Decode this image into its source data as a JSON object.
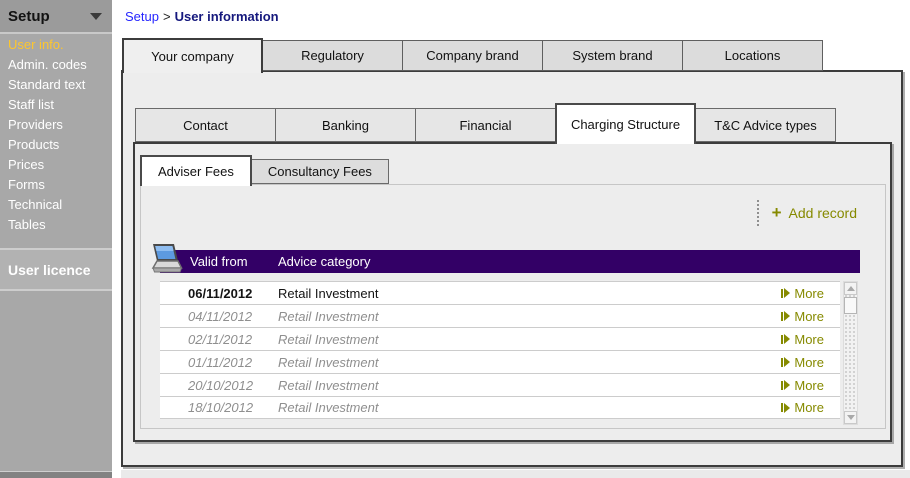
{
  "sidebar": {
    "title": "Setup",
    "items": [
      {
        "label": "User info.",
        "selected": true
      },
      {
        "label": "Admin. codes",
        "selected": false
      },
      {
        "label": "Standard text",
        "selected": false
      },
      {
        "label": "Staff list",
        "selected": false
      },
      {
        "label": "Providers",
        "selected": false
      },
      {
        "label": "Products",
        "selected": false
      },
      {
        "label": "Prices",
        "selected": false
      },
      {
        "label": "Forms",
        "selected": false
      },
      {
        "label": "Technical",
        "selected": false
      },
      {
        "label": "Tables",
        "selected": false
      }
    ],
    "section_title": "User licence"
  },
  "breadcrumb": {
    "link": "Setup",
    "separator": ">",
    "current": "User information"
  },
  "tabs": {
    "primary": [
      {
        "label": "Your company",
        "active": true
      },
      {
        "label": "Regulatory",
        "active": false
      },
      {
        "label": "Company brand",
        "active": false
      },
      {
        "label": "System brand",
        "active": false
      },
      {
        "label": "Locations",
        "active": false
      }
    ],
    "secondary": [
      {
        "label": "Contact",
        "active": false
      },
      {
        "label": "Banking",
        "active": false
      },
      {
        "label": "Financial",
        "active": false
      },
      {
        "label": "Charging Structure",
        "active": true
      },
      {
        "label": "T&C Advice types",
        "active": false
      }
    ],
    "fees": [
      {
        "label": "Adviser Fees",
        "active": true
      },
      {
        "label": "Consultancy Fees",
        "active": false
      }
    ]
  },
  "toolbar": {
    "add_icon": "+",
    "add_record_label": "Add record"
  },
  "table": {
    "columns": [
      "Valid from",
      "Advice category"
    ],
    "more_label": "More",
    "rows": [
      {
        "valid_from": "06/11/2012",
        "advice_category": "Retail Investment",
        "current": true
      },
      {
        "valid_from": "04/11/2012",
        "advice_category": "Retail Investment",
        "current": false
      },
      {
        "valid_from": "02/11/2012",
        "advice_category": "Retail Investment",
        "current": false
      },
      {
        "valid_from": "01/11/2012",
        "advice_category": "Retail Investment",
        "current": false
      },
      {
        "valid_from": "20/10/2012",
        "advice_category": "Retail Investment",
        "current": false
      },
      {
        "valid_from": "18/10/2012",
        "advice_category": "Retail Investment",
        "current": false
      }
    ]
  },
  "colors": {
    "header_purple": "#330066",
    "accent_olive": "#868a00",
    "sidebar_highlight": "#fdc62d",
    "link_blue": "#2626ff",
    "breadcrumb_navy": "#15187d"
  }
}
